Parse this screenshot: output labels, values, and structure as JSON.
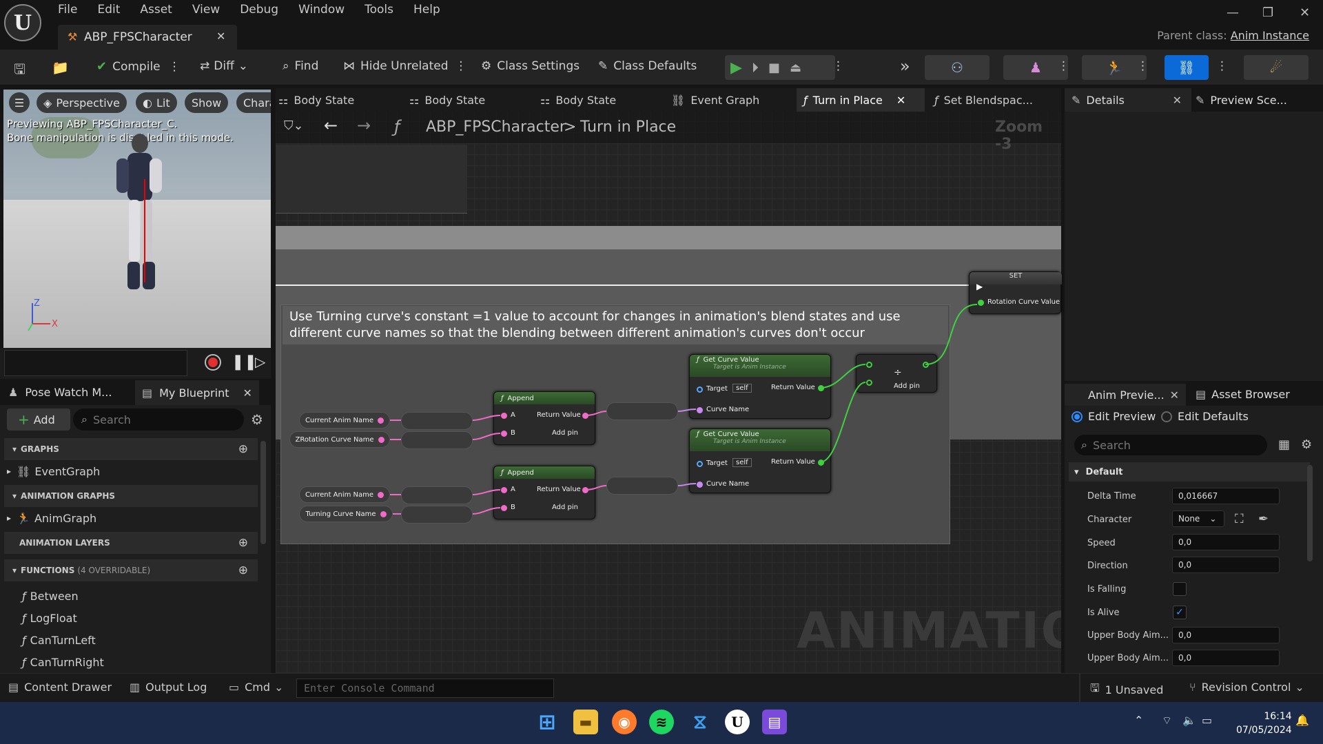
{
  "menu": [
    "File",
    "Edit",
    "Asset",
    "View",
    "Debug",
    "Window",
    "Tools",
    "Help"
  ],
  "asset_tab": "ABP_FPSCharacter",
  "parent_class": {
    "label": "Parent class:",
    "value": "Anim Instance"
  },
  "toolbar": {
    "compile": "Compile",
    "diff": "Diff",
    "find": "Find",
    "hide_unrelated": "Hide Unrelated",
    "class_settings": "Class Settings",
    "class_defaults": "Class Defaults"
  },
  "viewport": {
    "perspective": "Perspective",
    "lit": "Lit",
    "show": "Show",
    "chara": "Chara",
    "info_line1": "Previewing ABP_FPSCharacter_C.",
    "info_line2": "Bone manipulation is disabled in this mode."
  },
  "graph_tabs": [
    "Body State",
    "Body State",
    "Body State",
    "Event Graph",
    "Turn in Place",
    "Set Blendspac..."
  ],
  "breadcrumb": {
    "root": "ABP_FPSCharacter",
    "sep": ">",
    "leaf": "Turn in Place",
    "zoom": "Zoom -3"
  },
  "comment": "Use Turning curve's constant =1 value to account for changes in animation's blend states and use different curve names so that the blending between different animation's curves don't occur",
  "watermark": "ANIMATION",
  "nodes": {
    "set_title": "SET",
    "set_pin": "Rotation Curve Value",
    "append": "Append",
    "a": "A",
    "b": "B",
    "return_value": "Return Value",
    "add_pin": "Add pin",
    "get_curve": "Get Curve Value",
    "target_is": "Target is Anim Instance",
    "target": "Target",
    "self": "self",
    "curve_name": "Curve Name",
    "divide": "÷",
    "vars": [
      "Current Anim Name",
      "ZRotation Curve Name",
      "Current Anim Name",
      "Turning Curve Name"
    ]
  },
  "left_panel": {
    "tab1": "Pose Watch M...",
    "tab2": "My Blueprint",
    "add": "Add",
    "search_placeholder": "Search",
    "graphs": "GRAPHS",
    "event_graph": "EventGraph",
    "anim_graphs": "ANIMATION GRAPHS",
    "anim_graph": "AnimGraph",
    "anim_layers": "ANIMATION LAYERS",
    "functions": "FUNCTIONS",
    "functions_note": "(4 OVERRIDABLE)",
    "function_items": [
      "Between",
      "LogFloat",
      "CanTurnLeft",
      "CanTurnRight"
    ]
  },
  "details": {
    "tab": "Details",
    "tab2": "Preview Sce..."
  },
  "anim_preview": {
    "tab": "Anim Previe...",
    "tab2": "Asset Browser",
    "edit_preview": "Edit Preview",
    "edit_defaults": "Edit Defaults",
    "search_placeholder": "Search",
    "section": "Default",
    "props": [
      {
        "label": "Delta Time",
        "value": "0,016667"
      },
      {
        "label": "Character",
        "value": "None"
      },
      {
        "label": "Speed",
        "value": "0,0"
      },
      {
        "label": "Direction",
        "value": "0,0"
      },
      {
        "label": "Is Falling",
        "value": ""
      },
      {
        "label": "Is Alive",
        "value": "✓"
      },
      {
        "label": "Upper Body Aim...",
        "value": "0,0"
      },
      {
        "label": "Upper Body Aim...",
        "value": "0,0"
      }
    ]
  },
  "bottom": {
    "content_drawer": "Content Drawer",
    "output_log": "Output Log",
    "cmd": "Cmd",
    "console_placeholder": "Enter Console Command",
    "unsaved": "1 Unsaved",
    "revision": "Revision Control"
  },
  "taskbar": {
    "time": "16:14",
    "date": "07/05/2024"
  }
}
